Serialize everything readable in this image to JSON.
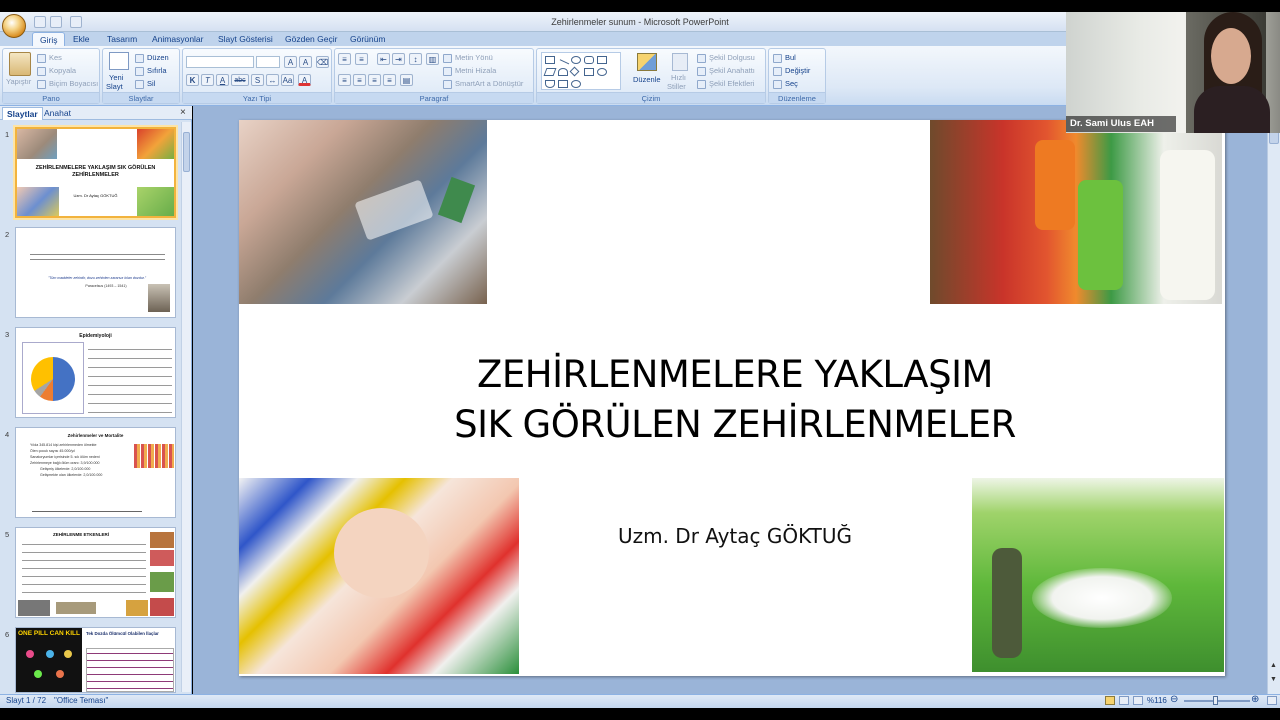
{
  "window": {
    "title": "Zehirlenmeler sunum - Microsoft PowerPoint"
  },
  "ribbon": {
    "tabs": [
      "Giriş",
      "Ekle",
      "Tasarım",
      "Animasyonlar",
      "Slayt Gösterisi",
      "Gözden Geçir",
      "Görünüm"
    ],
    "active_tab": "Giriş",
    "pano": {
      "label": "Pano",
      "paste": "Yapıştır",
      "cut": "Kes",
      "copy": "Kopyala",
      "format_painter": "Biçim Boyacısı"
    },
    "slaytlar": {
      "label": "Slaytlar",
      "new_slide_1": "Yeni",
      "new_slide_2": "Slayt",
      "layout": "Düzen",
      "reset": "Sıfırla",
      "delete": "Sil"
    },
    "yazi_tipi": {
      "label": "Yazı Tipi",
      "bold": "K",
      "italic": "T",
      "underline": "A",
      "strike": "abc",
      "shadow": "S"
    },
    "paragraf": {
      "label": "Paragraf",
      "text_direction": "Metin Yönü",
      "align_text": "Metni Hizala",
      "smartart": "SmartArt a Dönüştür"
    },
    "cizim": {
      "label": "Çizim",
      "arrange": "Düzenle",
      "quick_styles_1": "Hızlı",
      "quick_styles_2": "Stiller",
      "shape_fill": "Şekil Dolgusu",
      "shape_outline": "Şekil Anahattı",
      "shape_effects": "Şekil Efektleri"
    },
    "duzenleme": {
      "label": "Düzenleme",
      "find": "Bul",
      "replace": "Değiştir",
      "select": "Seç"
    }
  },
  "left_pane": {
    "tabs": [
      "Slaytlar",
      "Anahat"
    ],
    "close": "×",
    "slides": [
      {
        "num": "1",
        "title": "ZEHİRLENMELERE YAKLAŞIM SIK GÖRÜLEN ZEHİRLENMELER",
        "sub": "Uzm. Dr Aytaç GÖKTUĞ"
      },
      {
        "num": "2",
        "quote": "\"Tüm maddeler zehirdir, dozu zehirden zararsız kılan dozdur.\"",
        "sub": "Paracelsus (1493 – 1541)"
      },
      {
        "num": "3",
        "title": "Epidemiyoloji"
      },
      {
        "num": "4",
        "title": "Zehirlenmeler ve Mortalite",
        "lines": [
          "Yılda 345.814 kişi zehirlenmeden ölmekte",
          "Ölen çocuk sayısı 45.000/yıl",
          "Sanatoryumlar içerisinde 5. sık ölüm nedeni",
          "Zehirlenmeye bağlı ölüm oranı: 3,9/100.000",
          "Gelişmiş ülkelerde: 2,0/100.000",
          "Gelişmekte olan ülkelerde: 2,0/100.000"
        ]
      },
      {
        "num": "5",
        "title": "ZEHİRLENME ETKENLERİ"
      },
      {
        "num": "6",
        "banner": "ONE PILL CAN KILL",
        "title": "Tek Dozda Ölümcül Olabilen İlaçlar"
      }
    ]
  },
  "slide": {
    "title_line1": "ZEHİRLENMELERE YAKLAŞIM",
    "title_line2": "SIK GÖRÜLEN ZEHİRLENMELER",
    "author": "Uzm. Dr Aytaç GÖKTUĞ"
  },
  "status": {
    "slide_info": "Slayt 1 / 72",
    "theme": "\"Office Teması\"",
    "zoom": "%116"
  },
  "webcam": {
    "name": "Dr. Sami Ulus EAH"
  }
}
